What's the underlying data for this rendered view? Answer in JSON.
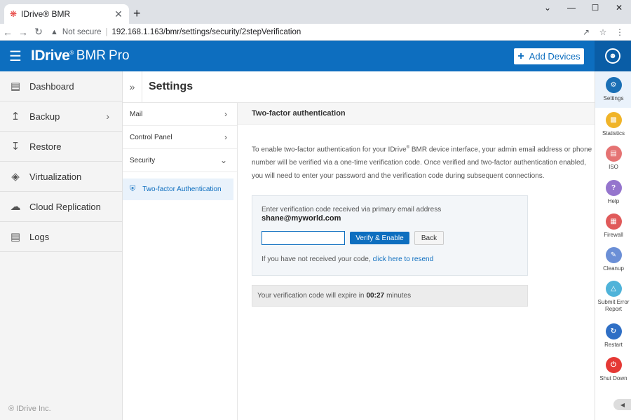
{
  "browser": {
    "tab_title": "IDrive® BMR",
    "new_tab": "+",
    "not_secure": "Not secure",
    "url": "192.168.1.163/bmr/settings/security/2stepVerification"
  },
  "header": {
    "logo": "IDrive",
    "logo_reg": "®",
    "logo_sub": "BMR",
    "logo_pro": "Pro",
    "add_devices": "Add Devices"
  },
  "sidebar": {
    "items": [
      {
        "label": "Dashboard",
        "icon": "dashboard-icon"
      },
      {
        "label": "Backup",
        "icon": "backup-icon"
      },
      {
        "label": "Restore",
        "icon": "restore-icon"
      },
      {
        "label": "Virtualization",
        "icon": "virtualization-icon"
      },
      {
        "label": "Cloud Replication",
        "icon": "cloud-icon"
      },
      {
        "label": "Logs",
        "icon": "logs-icon"
      }
    ],
    "copyright": "® IDrive Inc."
  },
  "page": {
    "title": "Settings"
  },
  "submenu": {
    "items": [
      {
        "label": "Mail"
      },
      {
        "label": "Control Panel"
      },
      {
        "label": "Security"
      }
    ],
    "active": "Two-factor Authentication"
  },
  "content": {
    "heading": "Two-factor authentication",
    "desc_part1": "To enable two-factor authentication for your IDrive",
    "desc_reg": "®",
    "desc_part2": " BMR device interface, your admin email address or phone number will be verified via a one-time verification code. Once verified and two-factor authentication enabled, you will need to enter your password and the verification code during subsequent connections.",
    "verify_label": "Enter verification code received via primary email address",
    "email": "shane@myworld.com",
    "code_value": "",
    "verify_button": "Verify & Enable",
    "back_button": "Back",
    "resend_text": "If you have not received your code, ",
    "resend_link": "click here to resend",
    "expiry_prefix": "Your verification code will expire in",
    "expiry_time": "00:27",
    "expiry_suffix": "minutes"
  },
  "rightrail": {
    "items": [
      {
        "label": "Settings",
        "color": "#1a6fb5",
        "icon": "gear-icon"
      },
      {
        "label": "Statistics",
        "color": "#f0b429",
        "icon": "chart-icon"
      },
      {
        "label": "ISO",
        "color": "#e57373",
        "icon": "iso-icon"
      },
      {
        "label": "Help",
        "color": "#9575cd",
        "icon": "help-icon"
      },
      {
        "label": "Firewall",
        "color": "#e05a5a",
        "icon": "firewall-icon"
      },
      {
        "label": "Cleanup",
        "color": "#6b8fd6",
        "icon": "cleanup-icon"
      },
      {
        "label": "Submit Error Report",
        "color": "#4fb3d9",
        "icon": "warning-icon"
      },
      {
        "label": "Restart",
        "color": "#2f6fc5",
        "icon": "restart-icon"
      },
      {
        "label": "Shut Down",
        "color": "#e53935",
        "icon": "power-icon"
      }
    ]
  }
}
